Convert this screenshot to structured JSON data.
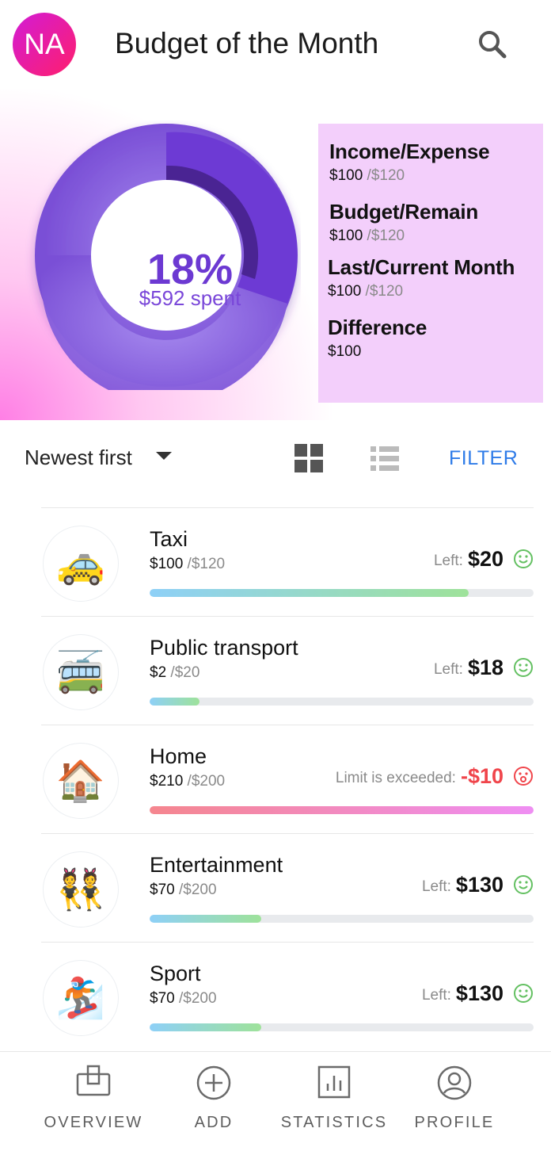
{
  "header": {
    "avatar_initials": "NA",
    "title": "Budget of the Month",
    "search_icon": "search-icon"
  },
  "summary": {
    "percent": "18%",
    "spent": "$592 spent",
    "spent_fraction": 0.18,
    "colors": {
      "ring_light": "#8a5ce0",
      "ring_dark": "#6b38d3",
      "track_dark": "#4b2495"
    },
    "stats": [
      {
        "label": "Income/Expense",
        "value": "$100",
        "of": " /$120"
      },
      {
        "label": "Budget/Remain",
        "value": "$100",
        "of": " /$120"
      },
      {
        "label": "Last/Current Month",
        "value": "$100",
        "of": " /$120"
      },
      {
        "label": "Difference",
        "value": "$100",
        "of": ""
      }
    ]
  },
  "toolbar": {
    "sort_label": "Newest first",
    "filter_label": "FILTER",
    "grid_icon": "grid-view-icon",
    "list_icon": "list-view-icon",
    "accent": "#2e7be8"
  },
  "items": [
    {
      "name": "Taxi",
      "value": "$100",
      "of": " /$120",
      "left_label": "Left:",
      "left_value": "$20",
      "emoji": "🚕",
      "progress": 0.83,
      "state": "ok"
    },
    {
      "name": "Public transport",
      "value": "$2",
      "of": " /$20",
      "left_label": "Left:",
      "left_value": "$18",
      "emoji": "🚎",
      "progress": 0.13,
      "state": "ok"
    },
    {
      "name": "Home",
      "value": "$210",
      "of": " /$200",
      "left_label": "Limit is exceeded:",
      "left_value": "-$10",
      "emoji": "🏠",
      "progress": 1.0,
      "state": "exceeded"
    },
    {
      "name": "Entertainment",
      "value": "$70",
      "of": " /$200",
      "left_label": "Left:",
      "left_value": "$130",
      "emoji": "👯",
      "progress": 0.29,
      "state": "ok"
    },
    {
      "name": "Sport",
      "value": "$70",
      "of": " /$200",
      "left_label": "Left:",
      "left_value": "$130",
      "emoji": "🏂",
      "progress": 0.29,
      "state": "ok"
    }
  ],
  "bottom_nav": [
    {
      "label": "OVERVIEW",
      "icon": "overview-icon"
    },
    {
      "label": "ADD",
      "icon": "add-icon"
    },
    {
      "label": "STATISTICS",
      "icon": "statistics-icon"
    },
    {
      "label": "PROFILE",
      "icon": "profile-icon"
    }
  ]
}
